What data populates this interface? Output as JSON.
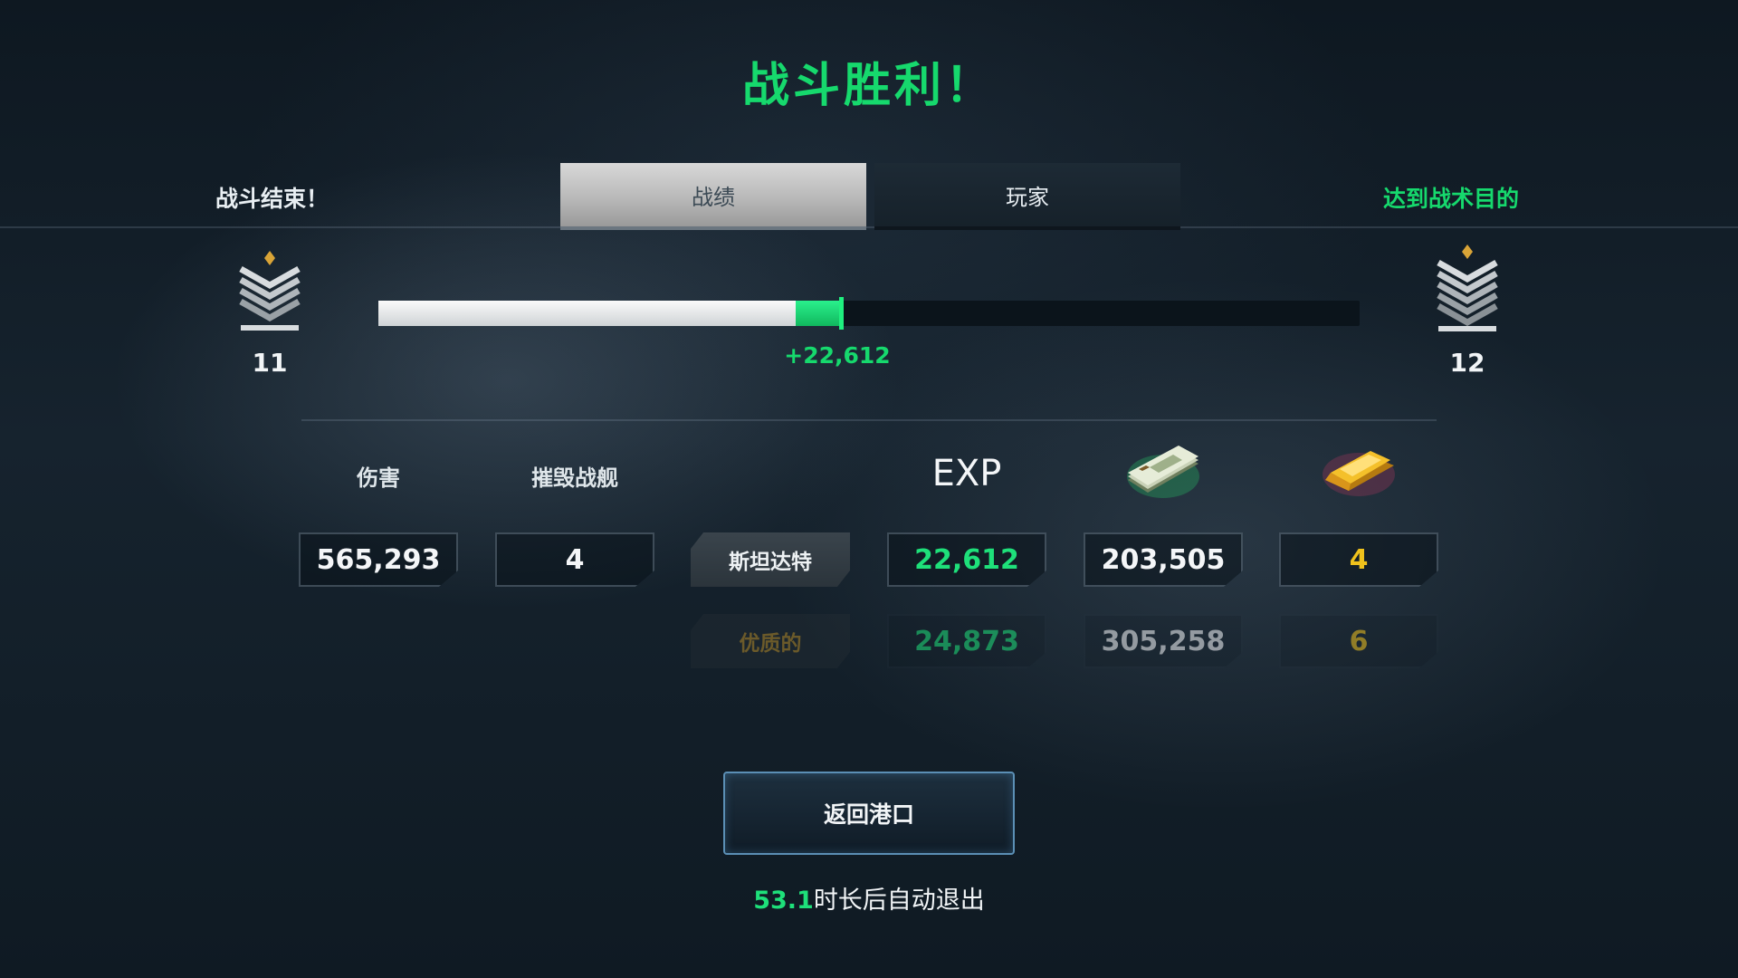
{
  "result": {
    "title": "战斗胜利！"
  },
  "header": {
    "left_status": "战斗结束！",
    "right_status": "达到战术目的",
    "tabs": [
      {
        "label": "战绩",
        "active": true
      },
      {
        "label": "玩家",
        "active": false
      }
    ]
  },
  "progress": {
    "current_rank": "11",
    "next_rank": "12",
    "previous_fraction": 0.425,
    "gained_fraction": 0.047,
    "gain_text": "+22,612"
  },
  "stats": {
    "headers": {
      "damage": "伤害",
      "kills": "摧毁战舰",
      "exp": "EXP",
      "credits_icon": "cash-icon",
      "gold_icon": "gold-bar-icon"
    },
    "standard": {
      "label": "斯坦达特",
      "damage": "565,293",
      "kills": "4",
      "exp": "22,612",
      "credits": "203,505",
      "gold": "4"
    },
    "premium": {
      "label": "优质的",
      "exp": "24,873",
      "credits": "305,258",
      "gold": "6"
    }
  },
  "footer": {
    "return_button": "返回港口",
    "countdown_value": "53.1",
    "countdown_text": "时长后自动退出"
  },
  "colors": {
    "accent_green": "#16d96d",
    "gold": "#f0c21c",
    "tab_active": "#c8c8c8"
  }
}
